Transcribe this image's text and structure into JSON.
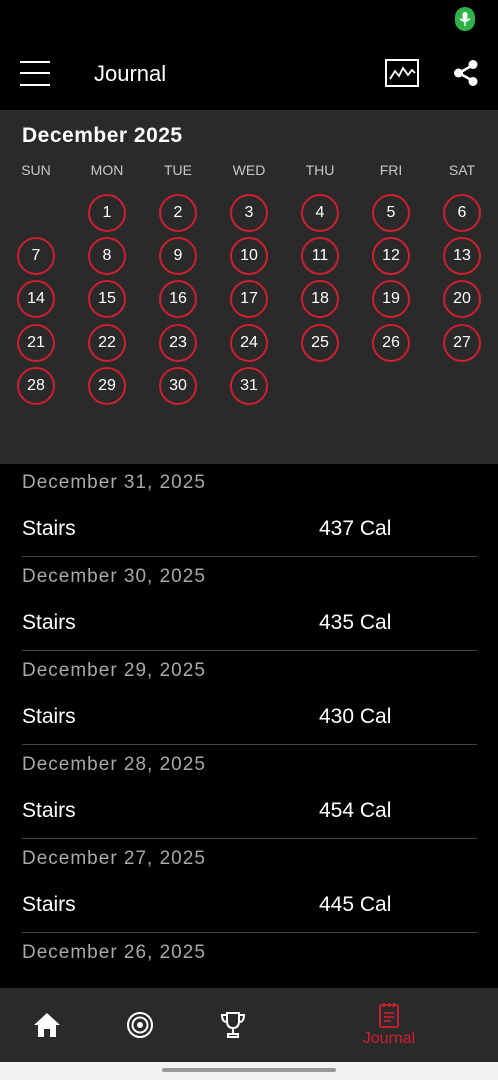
{
  "app_bar": {
    "title": "Journal",
    "icons": [
      "menu-icon",
      "activity-chart-icon",
      "share-icon"
    ]
  },
  "calendar": {
    "month_label": "December 2025",
    "weekdays": [
      "SUN",
      "MON",
      "TUE",
      "WED",
      "THU",
      "FRI",
      "SAT"
    ],
    "days": [
      "1",
      "2",
      "3",
      "4",
      "5",
      "6",
      "7",
      "8",
      "9",
      "10",
      "11",
      "12",
      "13",
      "14",
      "15",
      "16",
      "17",
      "18",
      "19",
      "20",
      "21",
      "22",
      "23",
      "24",
      "25",
      "26",
      "27",
      "28",
      "29",
      "30",
      "31"
    ],
    "ring_color": "#d01f2e"
  },
  "entries": [
    {
      "date": "December 31, 2025",
      "activity": "Stairs",
      "calories": "437 Cal"
    },
    {
      "date": "December 30, 2025",
      "activity": "Stairs",
      "calories": "435 Cal"
    },
    {
      "date": "December 29, 2025",
      "activity": "Stairs",
      "calories": "430 Cal"
    },
    {
      "date": "December 28, 2025",
      "activity": "Stairs",
      "calories": "454 Cal"
    },
    {
      "date": "December 27, 2025",
      "activity": "Stairs",
      "calories": "445 Cal"
    },
    {
      "date": "December 26, 2025",
      "activity": "",
      "calories": ""
    }
  ],
  "bottom_nav": {
    "items": [
      {
        "icon": "home-icon",
        "label": ""
      },
      {
        "icon": "target-icon",
        "label": ""
      },
      {
        "icon": "trophy-icon",
        "label": ""
      },
      {
        "icon": "journal-icon",
        "label": "Journal",
        "active": true
      }
    ],
    "active_color": "#d01f2e"
  },
  "colors": {
    "accent": "#d01f2e",
    "background": "#000000",
    "panel": "#2a2a2a",
    "mic_indicator": "#2fb24a"
  }
}
